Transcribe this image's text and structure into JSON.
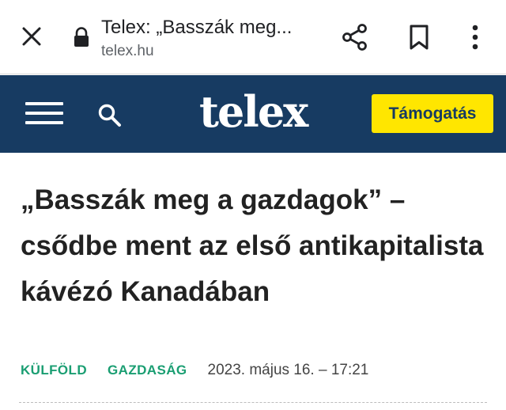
{
  "browser": {
    "tab_title": "Telex: „Basszák meg...",
    "url": "telex.hu",
    "icons": {
      "close": "close-icon",
      "lock": "lock-icon",
      "share": "share-icon",
      "bookmark": "bookmark-icon",
      "menu": "more-vert-icon"
    }
  },
  "site": {
    "logo_text": "telex",
    "support_label": "Támogatás",
    "icons": {
      "menu": "hamburger-icon",
      "search": "search-icon"
    },
    "colors": {
      "header_bg": "#173b62",
      "support_bg": "#ffe600",
      "tag_color": "#1a9e72"
    }
  },
  "article": {
    "headline": "„Basszák meg a gazdagok” – csődbe ment az első antikapitalista kávézó Kanadában",
    "tags": [
      "KÜLFÖLD",
      "GAZDASÁG"
    ],
    "date": "2023. május 16. – 17:21"
  }
}
